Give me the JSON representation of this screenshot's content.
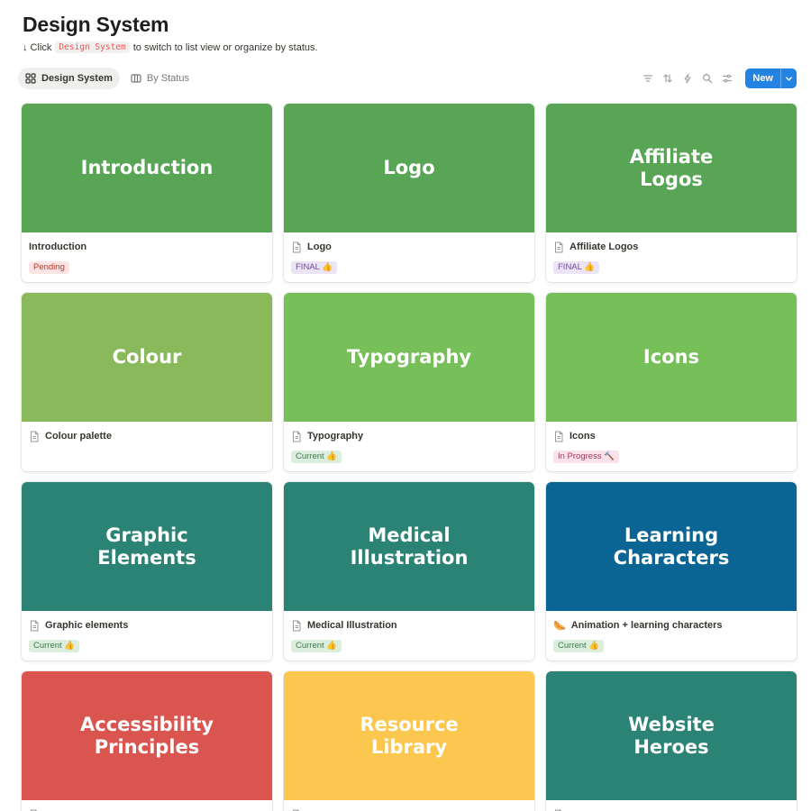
{
  "page": {
    "title": "Design System",
    "hint_prefix": "↓ Click",
    "hint_code": "Design System",
    "hint_suffix": "to switch to list view or organize by status."
  },
  "views": [
    {
      "label": "Design System",
      "icon": "gallery-grid-icon",
      "active": true
    },
    {
      "label": "By Status",
      "icon": "board-columns-icon",
      "active": false
    }
  ],
  "tools": [
    "filter-icon",
    "sort-icon",
    "automation-bolt-icon",
    "search-icon",
    "settings-sliders-icon"
  ],
  "new_button": {
    "label": "New"
  },
  "cards": [
    {
      "cover_text": "Introduction",
      "cover_color": "#58a555",
      "icon": "none",
      "name": "Introduction",
      "tag": "Pending",
      "tag_bg": "#fbe4e4",
      "tag_fg": "#b53d30"
    },
    {
      "cover_text": "Logo",
      "cover_color": "#58a555",
      "icon": "page-icon",
      "name": "Logo",
      "tag": "FINAL 👍",
      "tag_bg": "#ece3f5",
      "tag_fg": "#6f4f9a"
    },
    {
      "cover_text": "Affiliate\nLogos",
      "cover_color": "#58a555",
      "icon": "page-icon",
      "name": "Affiliate Logos",
      "tag": "FINAL 👍",
      "tag_bg": "#ece3f5",
      "tag_fg": "#6f4f9a"
    },
    {
      "cover_text": "Colour",
      "cover_color": "#8ab95c",
      "icon": "page-icon",
      "name": "Colour palette",
      "tag": "",
      "tag_bg": "",
      "tag_fg": ""
    },
    {
      "cover_text": "Typography",
      "cover_color": "#77bf59",
      "icon": "page-icon",
      "name": "Typography",
      "tag": "Current 👍",
      "tag_bg": "#dcefdf",
      "tag_fg": "#3f7a4a"
    },
    {
      "cover_text": "Icons",
      "cover_color": "#77bf59",
      "icon": "page-icon",
      "name": "Icons",
      "tag": "In Progress 🔨",
      "tag_bg": "#fbe1ea",
      "tag_fg": "#9a3a5c"
    },
    {
      "cover_text": "Graphic\nElements",
      "cover_color": "#2b8375",
      "icon": "page-icon",
      "name": "Graphic elements",
      "tag": "Current 👍",
      "tag_bg": "#dcefdf",
      "tag_fg": "#3f7a4a"
    },
    {
      "cover_text": "Medical\nIllustration",
      "cover_color": "#2b8375",
      "icon": "page-icon",
      "name": "Medical Illustration",
      "tag": "Current 👍",
      "tag_bg": "#dcefdf",
      "tag_fg": "#3f7a4a"
    },
    {
      "cover_text": "Learning\nCharacters",
      "cover_color": "#0b6594",
      "icon": "hotdog-emoji",
      "emoji": "🌭",
      "name": "Animation + learning characters",
      "tag": "Current 👍",
      "tag_bg": "#dcefdf",
      "tag_fg": "#3f7a4a"
    },
    {
      "cover_text": "Accessibility\nPrinciples",
      "cover_color": "#db5550",
      "icon": "page-icon",
      "name": "",
      "tag": "",
      "tag_bg": "",
      "tag_fg": ""
    },
    {
      "cover_text": "Resource\nLibrary",
      "cover_color": "#fbc74f",
      "icon": "page-icon",
      "name": "",
      "tag": "",
      "tag_bg": "",
      "tag_fg": ""
    },
    {
      "cover_text": "Website\nHeroes",
      "cover_color": "#2b8375",
      "icon": "page-icon",
      "name": "",
      "tag": "",
      "tag_bg": "",
      "tag_fg": ""
    }
  ]
}
